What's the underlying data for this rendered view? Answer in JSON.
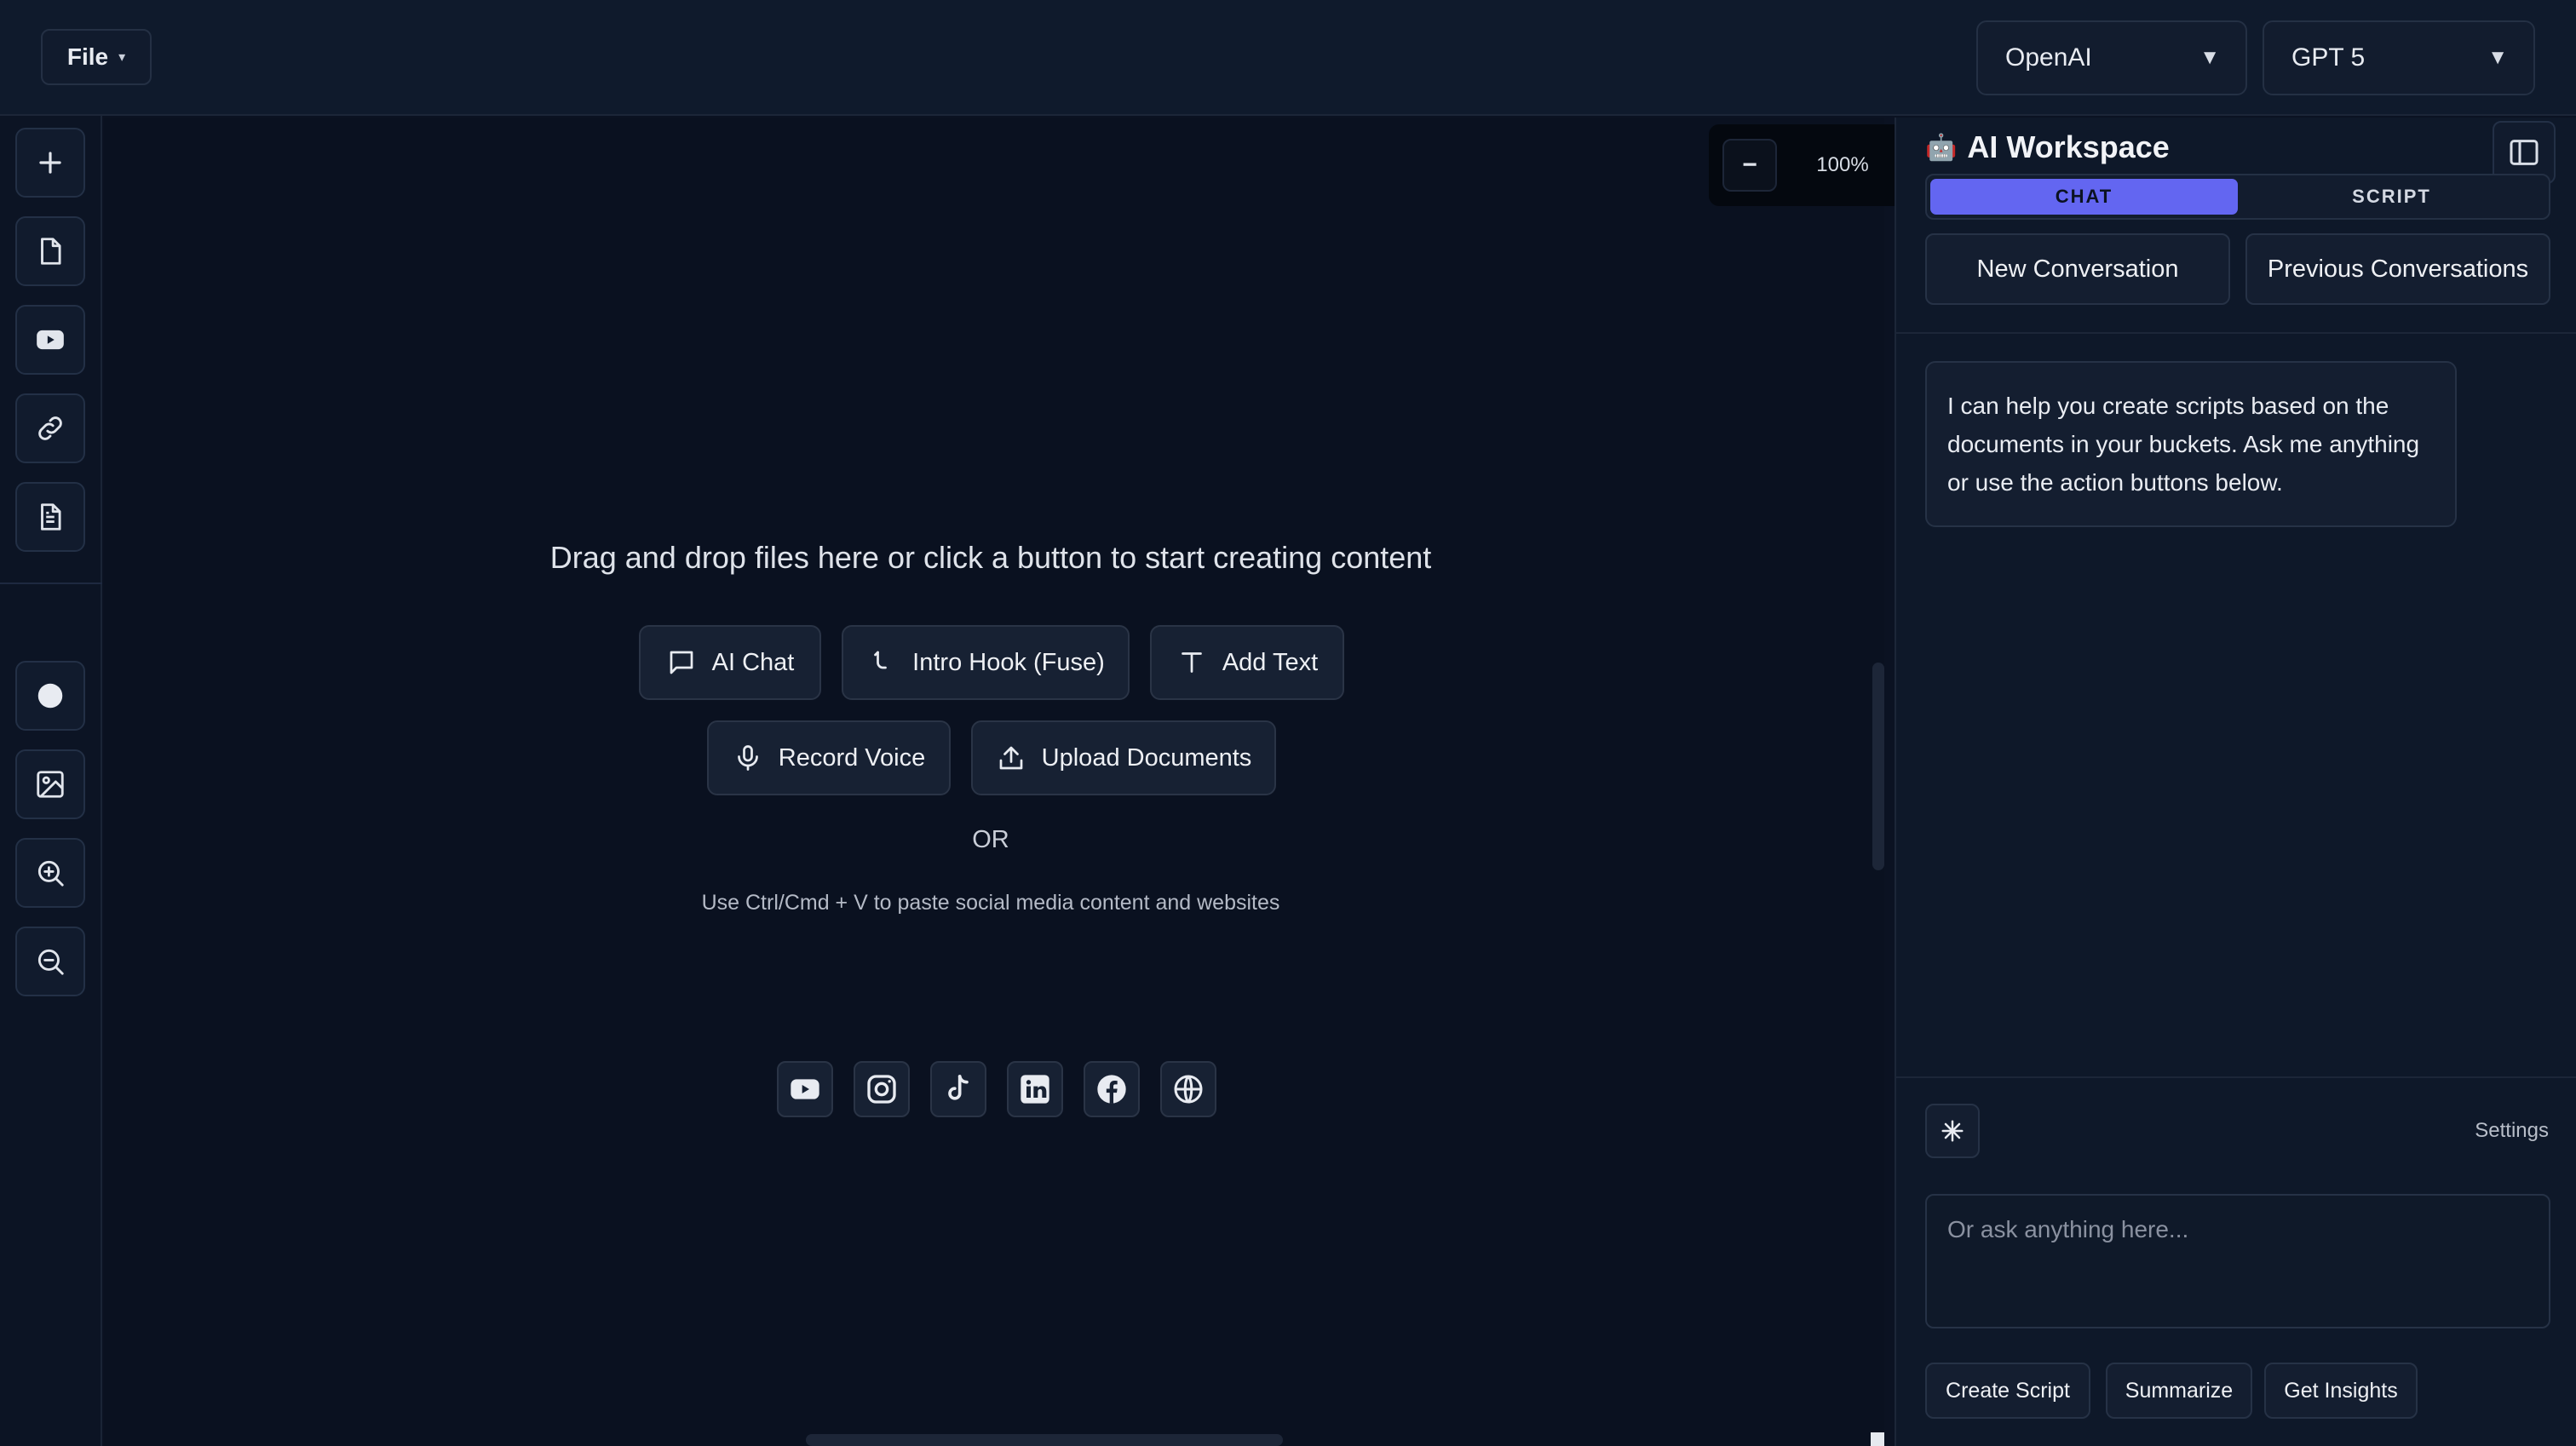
{
  "header": {
    "file_label": "File",
    "provider": "OpenAI",
    "model": "GPT 5"
  },
  "sidebar": {
    "tools": [
      {
        "icon": "plus-icon"
      },
      {
        "icon": "document-icon"
      },
      {
        "icon": "youtube-icon"
      },
      {
        "icon": "link-icon"
      },
      {
        "icon": "text-file-icon"
      },
      {
        "icon": "circle-icon"
      },
      {
        "icon": "image-icon"
      },
      {
        "icon": "zoom-in-icon"
      },
      {
        "icon": "zoom-out-icon"
      }
    ]
  },
  "canvas": {
    "zoom_out_label": "−",
    "zoom_level": "100%",
    "zoom_in_label": "+",
    "headline": "Drag and drop files here or click a button to start creating content",
    "buttons": {
      "ai_chat": "AI Chat",
      "intro_hook": "Intro Hook (Fuse)",
      "add_text": "Add Text",
      "record_voice": "Record Voice",
      "upload_documents": "Upload Documents"
    },
    "or_label": "OR",
    "paste_hint": "Use Ctrl/Cmd + V to paste social media content and websites",
    "social_icons": [
      "youtube-icon",
      "instagram-icon",
      "tiktok-icon",
      "linkedin-icon",
      "facebook-icon",
      "globe-icon"
    ]
  },
  "workspace": {
    "title": "AI Workspace",
    "tabs": [
      "CHAT",
      "SCRIPT"
    ],
    "active_tab": "CHAT",
    "new_conversation": "New Conversation",
    "previous_conversations": "Previous Conversations",
    "message": "I can help you create scripts based on the documents in your buckets. Ask me anything or use the action buttons below.",
    "settings_label": "Settings",
    "input_placeholder": "Or ask anything here...",
    "actions": {
      "create_script": "Create Script",
      "summarize": "Summarize",
      "get_insights": "Get Insights"
    }
  },
  "colors": {
    "background": "#0b1222",
    "accent": "#6366f1",
    "panel": "#0e1829"
  }
}
